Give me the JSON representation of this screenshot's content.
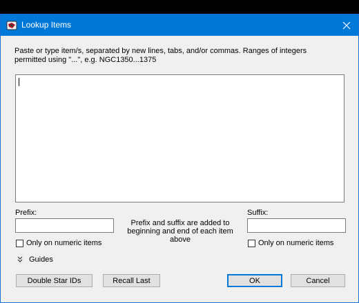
{
  "window": {
    "title": "Lookup Items"
  },
  "instructions": "Paste or type item/s, separated by new lines, tabs, and/or commas. Ranges of integers permitted using \"...\", e.g. NGC1350...1375",
  "items_input": {
    "value": ""
  },
  "prefix": {
    "label": "Prefix:",
    "value": "",
    "checkbox_label": "Only on numeric items",
    "checked": false
  },
  "suffix": {
    "label": "Suffix:",
    "value": "",
    "checkbox_label": "Only on numeric items",
    "checked": false
  },
  "note": "Prefix and suffix are added to beginning and end of each item above",
  "guides": {
    "label": "Guides",
    "icon": "double-chevron-down-icon"
  },
  "buttons": {
    "double_star": "Double Star IDs",
    "recall_last": "Recall Last",
    "ok": "OK",
    "cancel": "Cancel"
  },
  "colors": {
    "titlebar": "#0078d7",
    "dialog_bg": "#f0f0f0",
    "default_button_border": "#0078d7"
  }
}
